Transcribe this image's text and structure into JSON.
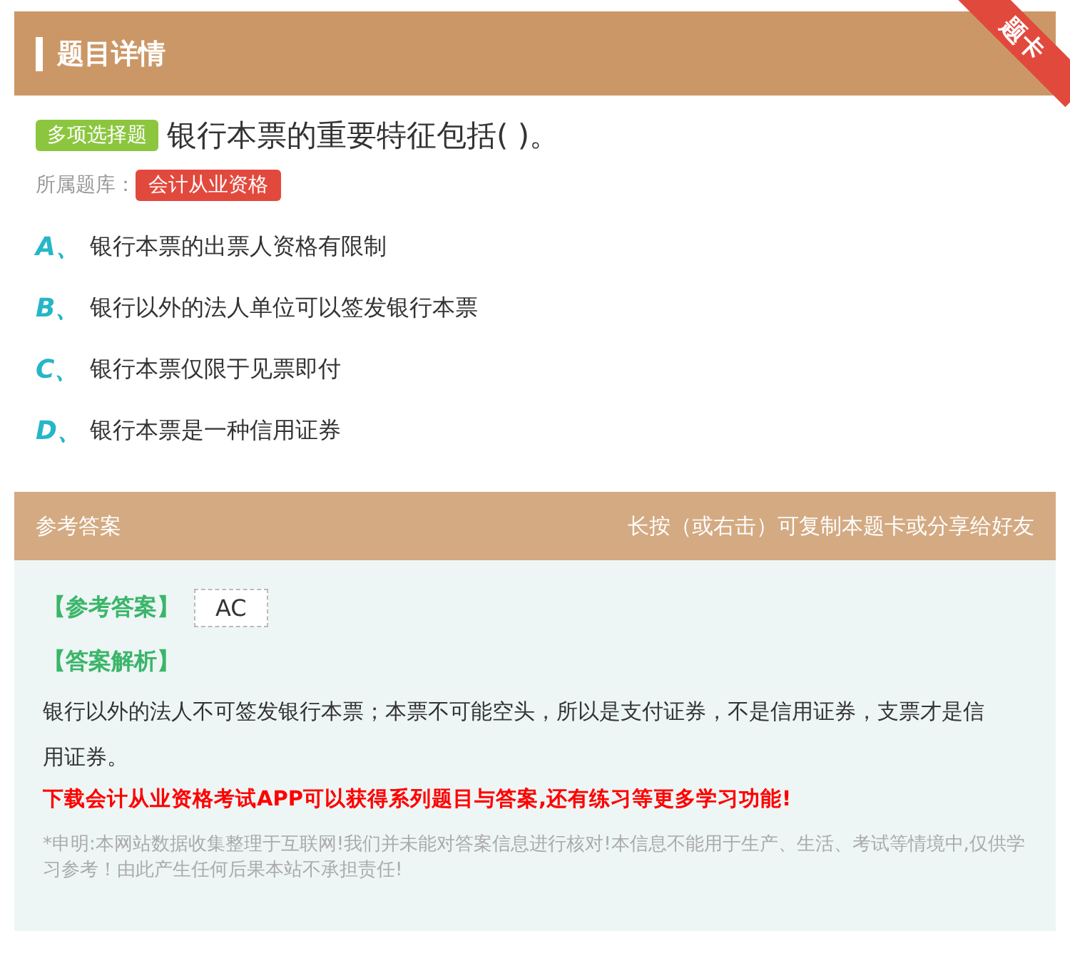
{
  "header": {
    "title": "题目详情",
    "ribbon": "题卡"
  },
  "question": {
    "type_tag": "多项选择题",
    "text": "银行本票的重要特征包括( )。",
    "bank_label": "所属题库：",
    "bank_tag": "会计从业资格"
  },
  "options": [
    {
      "letter": "A、",
      "text": "银行本票的出票人资格有限制"
    },
    {
      "letter": "B、",
      "text": "银行以外的法人单位可以签发银行本票"
    },
    {
      "letter": "C、",
      "text": "银行本票仅限于见票即付"
    },
    {
      "letter": "D、",
      "text": "银行本票是一种信用证券"
    }
  ],
  "answer_section": {
    "title": "参考答案",
    "hint": "长按（或右击）可复制本题卡或分享给好友",
    "answer_label": "【参考答案】",
    "answer": "AC",
    "analysis_label": "【答案解析】",
    "analysis": "银行以外的法人不可签发银行本票；本票不可能空头，所以是支付证券，不是信用证券，支票才是信用证券。",
    "promo": "下载会计从业资格考试APP可以获得系列题目与答案,还有练习等更多学习功能!",
    "disclaimer": "*申明:本网站数据收集整理于互联网!我们并未能对答案信息进行核对!本信息不能用于生产、生活、考试等情境中,仅供学习参考！由此产生任何后果本站不承担责任!"
  }
}
